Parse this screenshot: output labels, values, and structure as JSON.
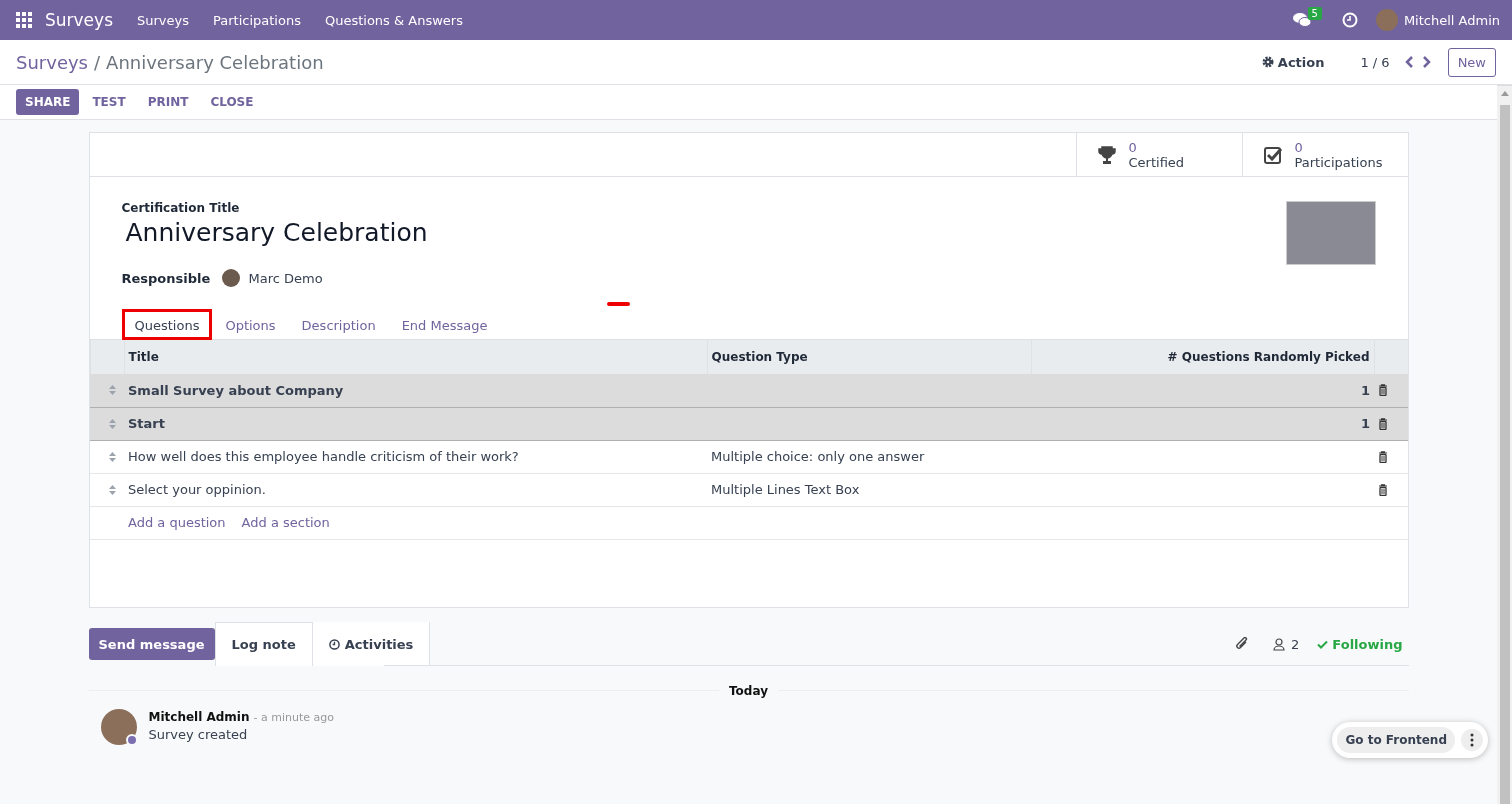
{
  "navbar": {
    "app": "Surveys",
    "menu": [
      "Surveys",
      "Participations",
      "Questions & Answers"
    ],
    "message_count": "5",
    "user": "Mitchell Admin"
  },
  "breadcrumb": {
    "parent": "Surveys",
    "separator": "/",
    "current": "Anniversary Celebration"
  },
  "control_panel": {
    "action": "Action",
    "pager": "1 / 6",
    "new_button": "New"
  },
  "buttons": [
    {
      "label": "SHARE",
      "primary": true
    },
    {
      "label": "TEST",
      "primary": false
    },
    {
      "label": "PRINT",
      "primary": false
    },
    {
      "label": "CLOSE",
      "primary": false
    }
  ],
  "stats": [
    {
      "kind": "trophy",
      "value": "0",
      "label": "Certified"
    },
    {
      "kind": "checkbox",
      "value": "0",
      "label": "Participations"
    }
  ],
  "form": {
    "title_label": "Certification Title",
    "title": "Anniversary Celebration",
    "responsible_label": "Responsible",
    "responsible": "Marc Demo"
  },
  "tabs": [
    {
      "label": "Questions",
      "selected": true,
      "highlighted": true
    },
    {
      "label": "Options",
      "selected": false,
      "highlighted": false
    },
    {
      "label": "Description",
      "selected": false,
      "highlighted": false
    },
    {
      "label": "End Message",
      "selected": false,
      "highlighted": false
    }
  ],
  "table": {
    "columns": [
      "Title",
      "Question Type",
      "# Questions Randomly Picked"
    ],
    "rows": [
      {
        "kind": "section",
        "title": "Small Survey about Company",
        "type": "",
        "count": "1"
      },
      {
        "kind": "section",
        "title": "Start",
        "type": "",
        "count": "1"
      },
      {
        "kind": "question",
        "title": "How well does this employee handle criticism of their work?",
        "type": "Multiple choice: only one answer",
        "count": ""
      },
      {
        "kind": "question",
        "title": "Select your oppinion.",
        "type": "Multiple Lines Text Box",
        "count": ""
      }
    ],
    "add_links": [
      "Add a question",
      "Add a section"
    ]
  },
  "chatter": {
    "send_message": "Send message",
    "log_note": "Log note",
    "activities": "Activities",
    "followers": "2",
    "following": "Following",
    "date": "Today",
    "messages": [
      {
        "author": "Mitchell Admin",
        "time": "- a minute ago",
        "body": "Survey created"
      }
    ]
  },
  "floating": {
    "label": "Go to Frontend"
  }
}
